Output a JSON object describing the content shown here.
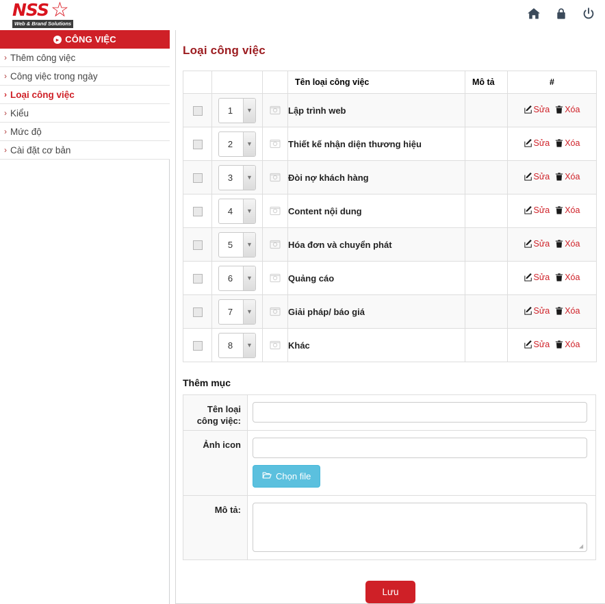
{
  "brand": {
    "name": "NSS",
    "star_icon": "star-icon",
    "tagline": "Web & Brand Solutions"
  },
  "topbar": {
    "icons": [
      {
        "name": "home-icon",
        "label": "Home"
      },
      {
        "name": "lock-icon",
        "label": "Lock"
      },
      {
        "name": "power-icon",
        "label": "Logout"
      }
    ]
  },
  "sidebar": {
    "header": "CÔNG VIỆC",
    "header_icon": "play-circle-icon",
    "items": [
      {
        "label": "Thêm công việc",
        "active": false
      },
      {
        "label": "Công việc trong ngày",
        "active": false
      },
      {
        "label": "Loại công việc",
        "active": true
      },
      {
        "label": "Kiểu",
        "active": false
      },
      {
        "label": "Mức độ",
        "active": false
      },
      {
        "label": "Cài đặt cơ bản",
        "active": false
      }
    ]
  },
  "main": {
    "page_title": "Loại công việc",
    "table": {
      "columns": [
        "",
        "",
        "",
        "Tên loại công việc",
        "Mô tả",
        "#"
      ],
      "actions": {
        "edit": "Sửa",
        "delete": "Xóa"
      },
      "rows": [
        {
          "order": "1",
          "name": "Lập trình web",
          "desc": ""
        },
        {
          "order": "2",
          "name": "Thiết kế nhận diện thương hiệu",
          "desc": ""
        },
        {
          "order": "3",
          "name": "Đòi nợ khách hàng",
          "desc": ""
        },
        {
          "order": "4",
          "name": "Content nội dung",
          "desc": ""
        },
        {
          "order": "5",
          "name": "Hóa đơn và chuyển phát",
          "desc": ""
        },
        {
          "order": "6",
          "name": "Quảng cáo",
          "desc": ""
        },
        {
          "order": "7",
          "name": "Giải pháp/ báo giá",
          "desc": ""
        },
        {
          "order": "8",
          "name": "Khác",
          "desc": ""
        }
      ]
    },
    "form": {
      "title": "Thêm mục",
      "name_label": "Tên loại công việc:",
      "name_value": "",
      "icon_label": "Ảnh icon",
      "icon_value": "",
      "choose_file_button": "Chọn file",
      "choose_file_icon": "folder-open-icon",
      "desc_label": "Mô tả:",
      "desc_value": "",
      "save_button": "Lưu"
    }
  },
  "colors": {
    "brand_red": "#cf2027",
    "title_red": "#9c1c20",
    "info_blue": "#5bc0de",
    "sidebar_bg": "#e4e5e7",
    "row_stripe": "#f9f9f9"
  }
}
